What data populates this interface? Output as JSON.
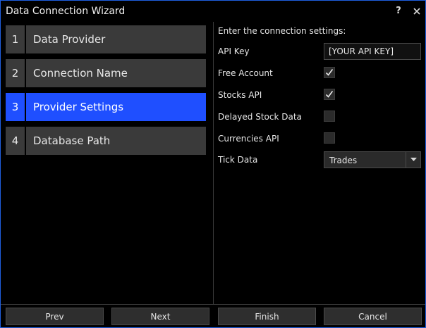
{
  "window": {
    "title": "Data Connection Wizard",
    "help_label": "?",
    "close_label": "✕"
  },
  "steps": [
    {
      "number": "1",
      "label": "Data Provider",
      "active": false
    },
    {
      "number": "2",
      "label": "Connection Name",
      "active": false
    },
    {
      "number": "3",
      "label": "Provider Settings",
      "active": true
    },
    {
      "number": "4",
      "label": "Database Path",
      "active": false
    }
  ],
  "settings": {
    "heading": "Enter the connection settings:",
    "api_key": {
      "label": "API Key",
      "value": "[YOUR API KEY]"
    },
    "free_account": {
      "label": "Free Account",
      "checked": true
    },
    "stocks_api": {
      "label": "Stocks API",
      "checked": true
    },
    "delayed_stock_data": {
      "label": "Delayed Stock Data",
      "checked": false
    },
    "currencies_api": {
      "label": "Currencies API",
      "checked": false
    },
    "tick_data": {
      "label": "Tick Data",
      "value": "Trades"
    }
  },
  "footer": {
    "prev_label": "Prev",
    "next_label": "Next",
    "finish_label": "Finish",
    "cancel_label": "Cancel"
  },
  "colors": {
    "accent": "#1f4fff",
    "window_border": "#1f5fe0",
    "background": "#000000"
  },
  "icons": {
    "check": "checkmark-icon",
    "dropdown": "chevron-down-icon"
  }
}
